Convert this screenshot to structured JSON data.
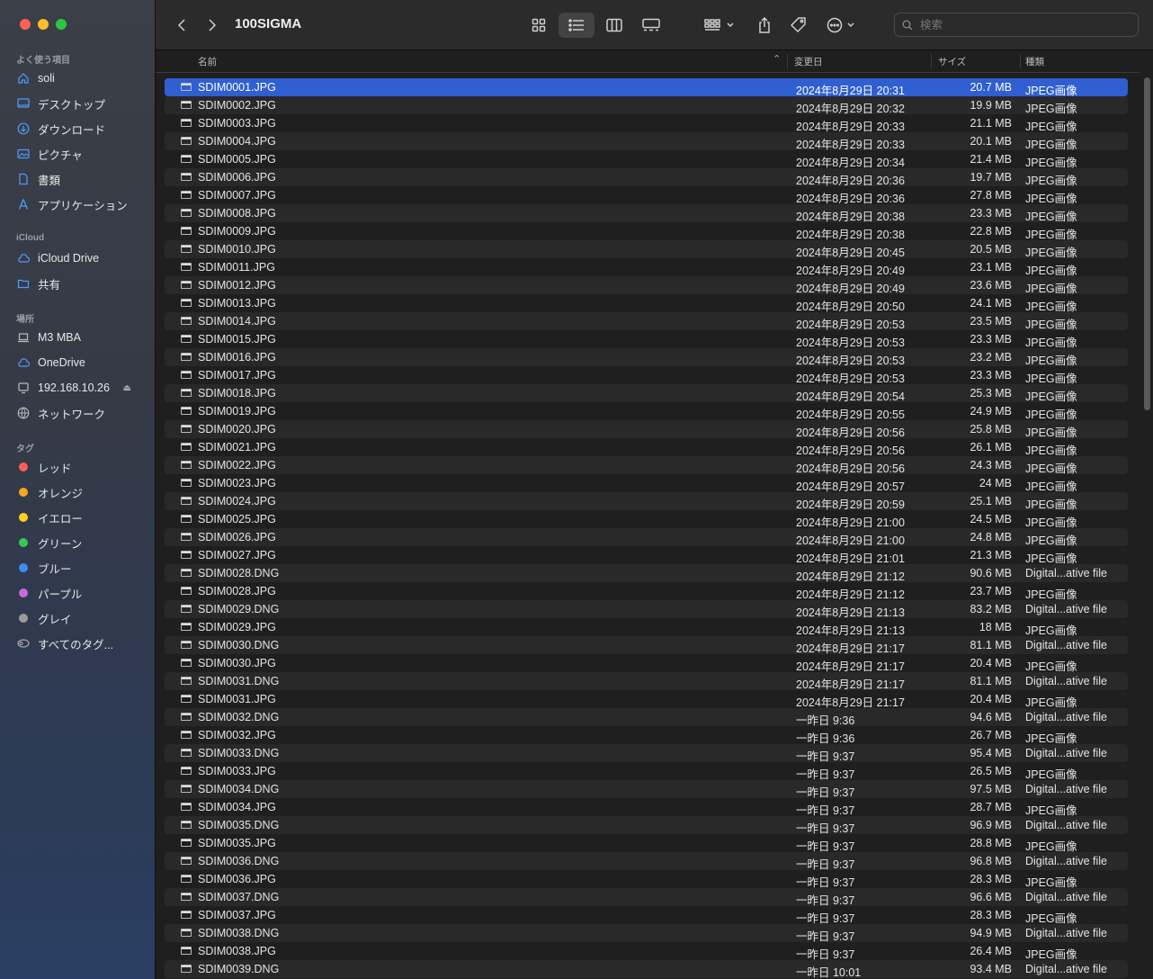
{
  "window": {
    "title": "100SIGMA"
  },
  "sidebar": {
    "favorites_label": "よく使う項目",
    "favorites": [
      {
        "label": "soli",
        "icon": "home-icon"
      },
      {
        "label": "デスクトップ",
        "icon": "desktop-icon"
      },
      {
        "label": "ダウンロード",
        "icon": "download-icon"
      },
      {
        "label": "ピクチャ",
        "icon": "pictures-icon"
      },
      {
        "label": "書類",
        "icon": "document-icon"
      },
      {
        "label": "アプリケーション",
        "icon": "applications-icon"
      }
    ],
    "icloud_label": "iCloud",
    "icloud": [
      {
        "label": "iCloud Drive",
        "icon": "cloud-icon"
      },
      {
        "label": "共有",
        "icon": "shared-folder-icon"
      }
    ],
    "locations_label": "場所",
    "locations": [
      {
        "label": "M3 MBA",
        "icon": "laptop-icon"
      },
      {
        "label": "OneDrive",
        "icon": "cloud-icon"
      },
      {
        "label": "192.168.10.26",
        "icon": "server-icon"
      },
      {
        "label": "ネットワーク",
        "icon": "network-icon"
      }
    ],
    "tags_label": "タグ",
    "tags": [
      {
        "label": "レッド",
        "color": "#fe5f57"
      },
      {
        "label": "オレンジ",
        "color": "#f5a623"
      },
      {
        "label": "イエロー",
        "color": "#f8d21c"
      },
      {
        "label": "グリーン",
        "color": "#34c759"
      },
      {
        "label": "ブルー",
        "color": "#3a8ef6"
      },
      {
        "label": "パープル",
        "color": "#c869e0"
      },
      {
        "label": "グレイ",
        "color": "#9a9a9a"
      }
    ],
    "all_tags": "すべてのタグ..."
  },
  "search": {
    "placeholder": "検索"
  },
  "columns": {
    "name": "名前",
    "date": "変更日",
    "size": "サイズ",
    "kind": "種類"
  },
  "files": [
    {
      "name": "SDIM0001.JPG",
      "date": "2024年8月29日 20:31",
      "size": "20.7 MB",
      "kind": "JPEG画像"
    },
    {
      "name": "SDIM0002.JPG",
      "date": "2024年8月29日 20:32",
      "size": "19.9 MB",
      "kind": "JPEG画像"
    },
    {
      "name": "SDIM0003.JPG",
      "date": "2024年8月29日 20:33",
      "size": "21.1 MB",
      "kind": "JPEG画像"
    },
    {
      "name": "SDIM0004.JPG",
      "date": "2024年8月29日 20:33",
      "size": "20.1 MB",
      "kind": "JPEG画像"
    },
    {
      "name": "SDIM0005.JPG",
      "date": "2024年8月29日 20:34",
      "size": "21.4 MB",
      "kind": "JPEG画像"
    },
    {
      "name": "SDIM0006.JPG",
      "date": "2024年8月29日 20:36",
      "size": "19.7 MB",
      "kind": "JPEG画像"
    },
    {
      "name": "SDIM0007.JPG",
      "date": "2024年8月29日 20:36",
      "size": "27.8 MB",
      "kind": "JPEG画像"
    },
    {
      "name": "SDIM0008.JPG",
      "date": "2024年8月29日 20:38",
      "size": "23.3 MB",
      "kind": "JPEG画像"
    },
    {
      "name": "SDIM0009.JPG",
      "date": "2024年8月29日 20:38",
      "size": "22.8 MB",
      "kind": "JPEG画像"
    },
    {
      "name": "SDIM0010.JPG",
      "date": "2024年8月29日 20:45",
      "size": "20.5 MB",
      "kind": "JPEG画像"
    },
    {
      "name": "SDIM0011.JPG",
      "date": "2024年8月29日 20:49",
      "size": "23.1 MB",
      "kind": "JPEG画像"
    },
    {
      "name": "SDIM0012.JPG",
      "date": "2024年8月29日 20:49",
      "size": "23.6 MB",
      "kind": "JPEG画像"
    },
    {
      "name": "SDIM0013.JPG",
      "date": "2024年8月29日 20:50",
      "size": "24.1 MB",
      "kind": "JPEG画像"
    },
    {
      "name": "SDIM0014.JPG",
      "date": "2024年8月29日 20:53",
      "size": "23.5 MB",
      "kind": "JPEG画像"
    },
    {
      "name": "SDIM0015.JPG",
      "date": "2024年8月29日 20:53",
      "size": "23.3 MB",
      "kind": "JPEG画像"
    },
    {
      "name": "SDIM0016.JPG",
      "date": "2024年8月29日 20:53",
      "size": "23.2 MB",
      "kind": "JPEG画像"
    },
    {
      "name": "SDIM0017.JPG",
      "date": "2024年8月29日 20:53",
      "size": "23.3 MB",
      "kind": "JPEG画像"
    },
    {
      "name": "SDIM0018.JPG",
      "date": "2024年8月29日 20:54",
      "size": "25.3 MB",
      "kind": "JPEG画像"
    },
    {
      "name": "SDIM0019.JPG",
      "date": "2024年8月29日 20:55",
      "size": "24.9 MB",
      "kind": "JPEG画像"
    },
    {
      "name": "SDIM0020.JPG",
      "date": "2024年8月29日 20:56",
      "size": "25.8 MB",
      "kind": "JPEG画像"
    },
    {
      "name": "SDIM0021.JPG",
      "date": "2024年8月29日 20:56",
      "size": "26.1 MB",
      "kind": "JPEG画像"
    },
    {
      "name": "SDIM0022.JPG",
      "date": "2024年8月29日 20:56",
      "size": "24.3 MB",
      "kind": "JPEG画像"
    },
    {
      "name": "SDIM0023.JPG",
      "date": "2024年8月29日 20:57",
      "size": "24 MB",
      "kind": "JPEG画像"
    },
    {
      "name": "SDIM0024.JPG",
      "date": "2024年8月29日 20:59",
      "size": "25.1 MB",
      "kind": "JPEG画像"
    },
    {
      "name": "SDIM0025.JPG",
      "date": "2024年8月29日 21:00",
      "size": "24.5 MB",
      "kind": "JPEG画像"
    },
    {
      "name": "SDIM0026.JPG",
      "date": "2024年8月29日 21:00",
      "size": "24.8 MB",
      "kind": "JPEG画像"
    },
    {
      "name": "SDIM0027.JPG",
      "date": "2024年8月29日 21:01",
      "size": "21.3 MB",
      "kind": "JPEG画像"
    },
    {
      "name": "SDIM0028.DNG",
      "date": "2024年8月29日 21:12",
      "size": "90.6 MB",
      "kind": "Digital...ative file"
    },
    {
      "name": "SDIM0028.JPG",
      "date": "2024年8月29日 21:12",
      "size": "23.7 MB",
      "kind": "JPEG画像"
    },
    {
      "name": "SDIM0029.DNG",
      "date": "2024年8月29日 21:13",
      "size": "83.2 MB",
      "kind": "Digital...ative file"
    },
    {
      "name": "SDIM0029.JPG",
      "date": "2024年8月29日 21:13",
      "size": "18 MB",
      "kind": "JPEG画像"
    },
    {
      "name": "SDIM0030.DNG",
      "date": "2024年8月29日 21:17",
      "size": "81.1 MB",
      "kind": "Digital...ative file"
    },
    {
      "name": "SDIM0030.JPG",
      "date": "2024年8月29日 21:17",
      "size": "20.4 MB",
      "kind": "JPEG画像"
    },
    {
      "name": "SDIM0031.DNG",
      "date": "2024年8月29日 21:17",
      "size": "81.1 MB",
      "kind": "Digital...ative file"
    },
    {
      "name": "SDIM0031.JPG",
      "date": "2024年8月29日 21:17",
      "size": "20.4 MB",
      "kind": "JPEG画像"
    },
    {
      "name": "SDIM0032.DNG",
      "date": "一昨日 9:36",
      "size": "94.6 MB",
      "kind": "Digital...ative file"
    },
    {
      "name": "SDIM0032.JPG",
      "date": "一昨日 9:36",
      "size": "26.7 MB",
      "kind": "JPEG画像"
    },
    {
      "name": "SDIM0033.DNG",
      "date": "一昨日 9:37",
      "size": "95.4 MB",
      "kind": "Digital...ative file"
    },
    {
      "name": "SDIM0033.JPG",
      "date": "一昨日 9:37",
      "size": "26.5 MB",
      "kind": "JPEG画像"
    },
    {
      "name": "SDIM0034.DNG",
      "date": "一昨日 9:37",
      "size": "97.5 MB",
      "kind": "Digital...ative file"
    },
    {
      "name": "SDIM0034.JPG",
      "date": "一昨日 9:37",
      "size": "28.7 MB",
      "kind": "JPEG画像"
    },
    {
      "name": "SDIM0035.DNG",
      "date": "一昨日 9:37",
      "size": "96.9 MB",
      "kind": "Digital...ative file"
    },
    {
      "name": "SDIM0035.JPG",
      "date": "一昨日 9:37",
      "size": "28.8 MB",
      "kind": "JPEG画像"
    },
    {
      "name": "SDIM0036.DNG",
      "date": "一昨日 9:37",
      "size": "96.8 MB",
      "kind": "Digital...ative file"
    },
    {
      "name": "SDIM0036.JPG",
      "date": "一昨日 9:37",
      "size": "28.3 MB",
      "kind": "JPEG画像"
    },
    {
      "name": "SDIM0037.DNG",
      "date": "一昨日 9:37",
      "size": "96.6 MB",
      "kind": "Digital...ative file"
    },
    {
      "name": "SDIM0037.JPG",
      "date": "一昨日 9:37",
      "size": "28.3 MB",
      "kind": "JPEG画像"
    },
    {
      "name": "SDIM0038.DNG",
      "date": "一昨日 9:37",
      "size": "94.9 MB",
      "kind": "Digital...ative file"
    },
    {
      "name": "SDIM0038.JPG",
      "date": "一昨日 9:37",
      "size": "26.4 MB",
      "kind": "JPEG画像"
    },
    {
      "name": "SDIM0039.DNG",
      "date": "一昨日 10:01",
      "size": "93.4 MB",
      "kind": "Digital...ative file"
    }
  ],
  "selected_index": 0,
  "colors": {
    "accent": "#2f5fd0",
    "sidebar_icon": "#4f9bff"
  }
}
